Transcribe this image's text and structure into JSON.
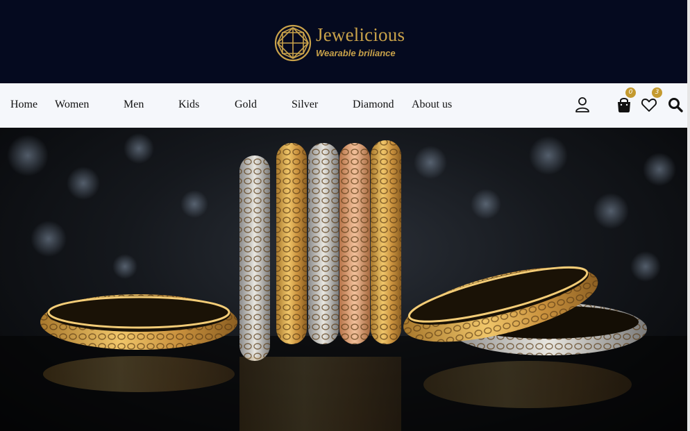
{
  "brand": {
    "name": "Jewelicious",
    "tagline": "Wearable briliance",
    "logo_icon": "diamond-logo-icon",
    "color_gold": "#c9a24a",
    "color_header_bg": "#050a1f"
  },
  "nav": {
    "items": [
      {
        "label": "Home"
      },
      {
        "label": "Women"
      },
      {
        "label": "Men"
      },
      {
        "label": "Kids"
      },
      {
        "label": "Gold"
      },
      {
        "label": "Silver"
      },
      {
        "label": "Diamond"
      },
      {
        "label": "About us"
      }
    ],
    "icons": {
      "account": "user-icon",
      "cart": "shopping-bag-icon",
      "wishlist": "heart-icon",
      "search": "search-icon"
    },
    "cart_count": "0",
    "wishlist_count": "3",
    "badge_color": "#c49a2f"
  },
  "hero": {
    "image": "gold-bangles-banner"
  }
}
